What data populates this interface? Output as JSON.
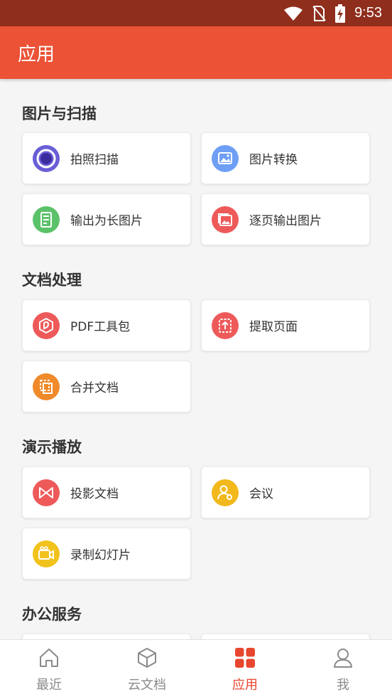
{
  "status_bar": {
    "time": "9:53",
    "icons": [
      "wifi-icon",
      "no-sim-icon",
      "battery-charging-icon"
    ]
  },
  "header": {
    "title": "应用"
  },
  "sections": [
    {
      "title": "图片与扫描",
      "items": [
        {
          "label": "拍照扫描",
          "icon": "scan-camera-icon",
          "color": "#6a5ed6"
        },
        {
          "label": "图片转换",
          "icon": "image-convert-icon",
          "color": "#6e9ef5"
        },
        {
          "label": "输出为长图片",
          "icon": "long-image-icon",
          "color": "#5cc26a"
        },
        {
          "label": "逐页输出图片",
          "icon": "page-images-icon",
          "color": "#ee5a5a"
        }
      ]
    },
    {
      "title": "文档处理",
      "items": [
        {
          "label": "PDF工具包",
          "icon": "pdf-toolkit-icon",
          "color": "#ee5a5a"
        },
        {
          "label": "提取页面",
          "icon": "extract-page-icon",
          "color": "#ee5a5a"
        },
        {
          "label": "合并文档",
          "icon": "merge-document-icon",
          "color": "#f08a2a"
        }
      ]
    },
    {
      "title": "演示播放",
      "items": [
        {
          "label": "投影文档",
          "icon": "projection-icon",
          "color": "#ee5a5a"
        },
        {
          "label": "会议",
          "icon": "meeting-icon",
          "color": "#f2b81c"
        },
        {
          "label": "录制幻灯片",
          "icon": "record-slides-icon",
          "color": "#f2c21c"
        }
      ]
    },
    {
      "title": "办公服务",
      "items": []
    }
  ],
  "bottom_nav": [
    {
      "label": "最近",
      "icon": "home-icon",
      "active": false
    },
    {
      "label": "云文档",
      "icon": "cloud-box-icon",
      "active": false
    },
    {
      "label": "应用",
      "icon": "apps-grid-icon",
      "active": true
    },
    {
      "label": "我",
      "icon": "user-icon",
      "active": false
    }
  ],
  "colors": {
    "status_bar": "#8f2e1d",
    "accent": "#eb5236",
    "active_nav": "#e8472f"
  }
}
